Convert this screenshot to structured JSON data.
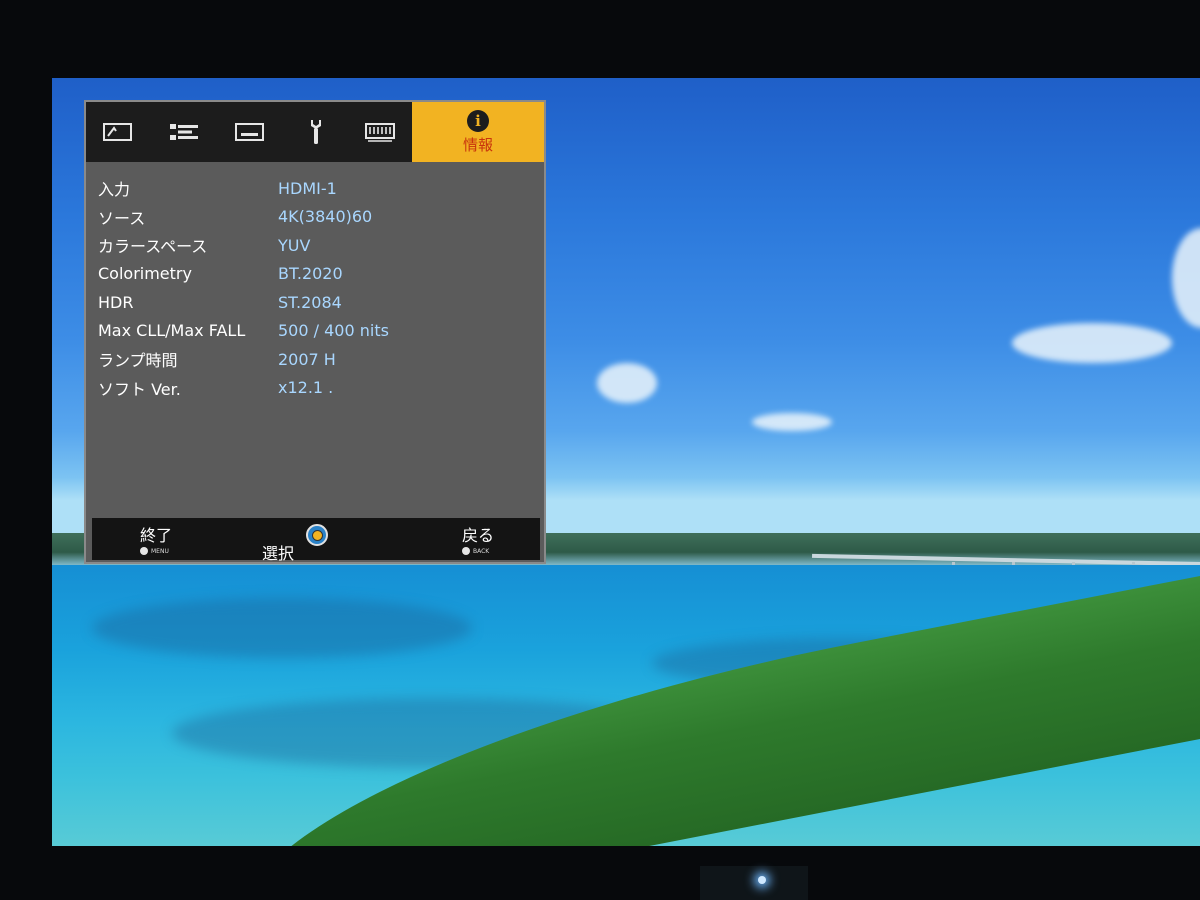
{
  "menu": {
    "tabs": [
      {
        "icon": "picture-adjust-icon"
      },
      {
        "icon": "input-settings-icon"
      },
      {
        "icon": "display-icon"
      },
      {
        "icon": "wrench-icon"
      },
      {
        "icon": "network-icon"
      },
      {
        "icon": "info-icon",
        "label": "情報",
        "active": true
      }
    ],
    "info_rows": [
      {
        "key": "入力",
        "value": "HDMI-1"
      },
      {
        "key": "ソース",
        "value": "4K(3840)60"
      },
      {
        "key": "カラースペース",
        "value": "YUV"
      },
      {
        "key": "Colorimetry",
        "value": "BT.2020"
      },
      {
        "key": "HDR",
        "value": "ST.2084"
      },
      {
        "key": "Max CLL/Max FALL",
        "value": "500 / 400 nits"
      },
      {
        "key": "ランプ時間",
        "value": "2007 H"
      },
      {
        "key": "ソフト Ver.",
        "value": "x12.1 ."
      }
    ],
    "footer": {
      "exit_label": "終了",
      "exit_key": "MENU",
      "select_label": "選択",
      "back_label": "戻る",
      "back_key": "BACK"
    }
  },
  "colors": {
    "menu_bg": "#5b5b5b",
    "tab_bar": "#1c1c1c",
    "active_tab": "#f2b322",
    "active_label": "#c8330c",
    "value_text": "#a9d7ff"
  }
}
